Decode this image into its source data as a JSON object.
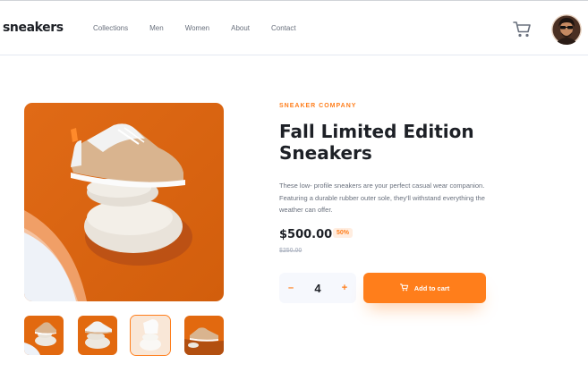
{
  "brand": {
    "logo": "sneakers"
  },
  "nav": {
    "items": [
      {
        "label": "Collections"
      },
      {
        "label": "Men"
      },
      {
        "label": "Women"
      },
      {
        "label": "About"
      },
      {
        "label": "Contact"
      }
    ]
  },
  "header": {
    "cart_icon": "cart-icon",
    "avatar": "user-avatar"
  },
  "gallery": {
    "main_image": "sneaker-on-stones",
    "thumbnails": [
      {
        "name": "thumbnail-1"
      },
      {
        "name": "thumbnail-2"
      },
      {
        "name": "thumbnail-3",
        "selected": true
      },
      {
        "name": "thumbnail-4"
      }
    ]
  },
  "product": {
    "company": "SNEAKER COMPANY",
    "title": "Fall Limited Edition Sneakers",
    "description": "These low- profile sneakers are your perfect casual wear companion. Featuring a durable rubber outer sole, they'll withstand everything the weather can offer.",
    "price": "$500.00",
    "discount": "50%",
    "old_price": "$250.00"
  },
  "quantity": {
    "minus": "–",
    "value": "4",
    "plus": "+"
  },
  "actions": {
    "add_to_cart": "Add to cart"
  },
  "colors": {
    "accent": "#ff7e1b",
    "accent_pale": "#ffede0",
    "text_dark": "#1d2026",
    "text_muted": "#69707d"
  }
}
